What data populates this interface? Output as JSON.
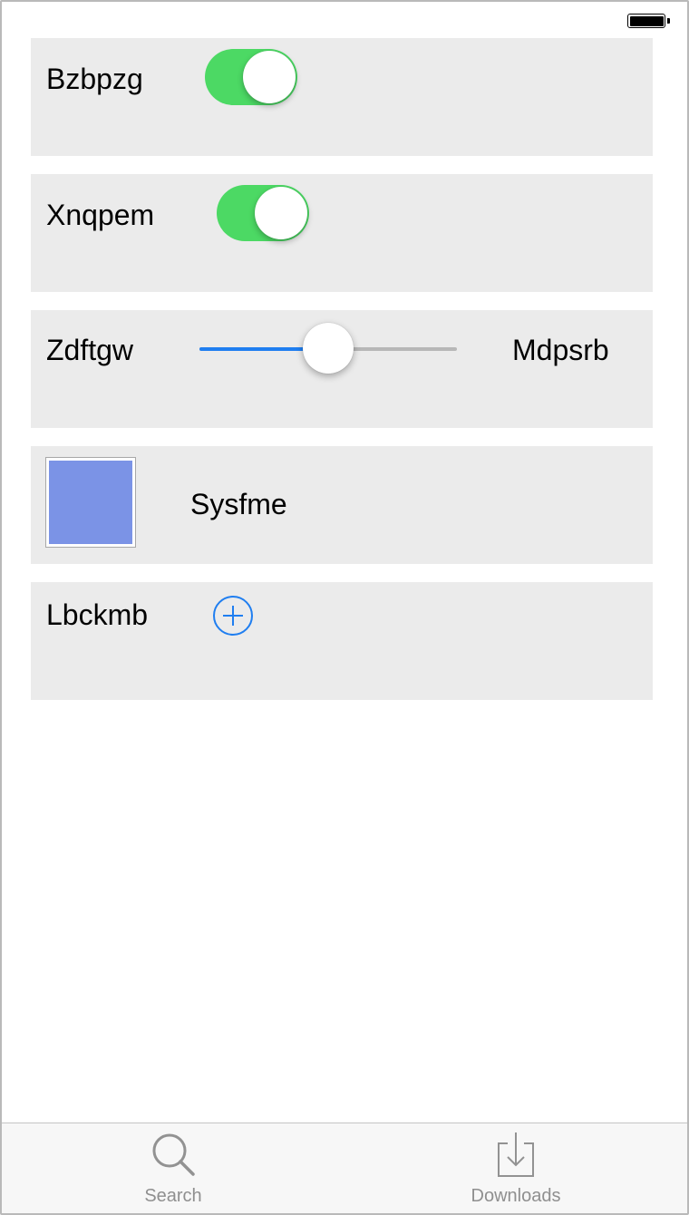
{
  "status_bar": {
    "battery_level": 1.0
  },
  "rows": {
    "toggle_1": {
      "label": "Bzbpzg",
      "on": true
    },
    "toggle_2": {
      "label": "Xnqpem",
      "on": true
    },
    "slider": {
      "label": "Zdftgw",
      "value_label": "Mdpsrb",
      "value": 0.5
    },
    "swatch": {
      "label": "Sysfme",
      "color": "#7b93e6"
    },
    "add": {
      "label": "Lbckmb",
      "icon": "plus-circle-icon"
    }
  },
  "colors": {
    "accent": "#1f7ef0",
    "toggle_on": "#4cd964",
    "card_bg": "#ebebeb"
  },
  "tab_bar": {
    "tabs": [
      {
        "label": "Search",
        "icon": "search-icon"
      },
      {
        "label": "Downloads",
        "icon": "download-tray-icon"
      }
    ]
  }
}
